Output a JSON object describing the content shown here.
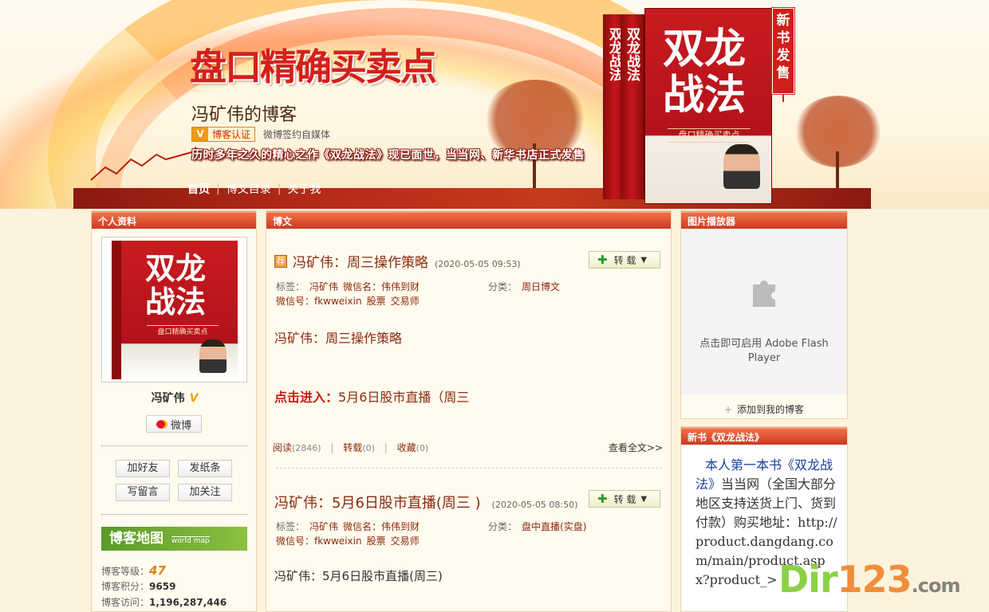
{
  "header": {
    "banner_title": "盘口精确买卖点",
    "blog_name": "冯矿伟的博客",
    "cert_badge": "博客认证",
    "cert_text": "微博签约自媒体",
    "announcement": "历时多年之久的精心之作《双龙战法》现已面世，当当网、新华书店正式发售",
    "nav": [
      {
        "label": "首页"
      },
      {
        "label": "博文目录"
      },
      {
        "label": "关于我"
      }
    ],
    "book_title_line1": "双龙",
    "book_title_line2": "战法",
    "book_subtitle": "盘口精确买卖点",
    "book_spine": "双龙战法",
    "new_tag": "新书发售"
  },
  "left": {
    "heading": "个人资料",
    "avatar_title_line1": "双龙",
    "avatar_title_line2": "战法",
    "avatar_subtitle": "盘口精确买卖点",
    "name": "冯矿伟",
    "weibo_btn": "微博",
    "buttons": [
      "加好友",
      "发纸条",
      "写留言",
      "加关注"
    ],
    "blog_map": "博客地图",
    "blog_map_sub": "world map",
    "stats": [
      {
        "label": "博客等级：",
        "value": "47"
      },
      {
        "label": "博客积分：",
        "value": "9659"
      },
      {
        "label": "博客访问：",
        "value": "1,196,287,446"
      }
    ]
  },
  "center": {
    "heading": "博文",
    "posts": [
      {
        "badge": "荐",
        "title": "冯矿伟：周三操作策略",
        "date": "(2020-05-05 09:53)",
        "share_label": "转 载",
        "tags_label": "标签：",
        "tags_line1": [
          "冯矿伟",
          "微信名：伟伟到财"
        ],
        "tags_line2": [
          "微信号：fkwweixin",
          "股票",
          "交易师"
        ],
        "category_label": "分类：",
        "category": "周日博文",
        "body": "冯矿伟：周三操作策略",
        "body2_prefix": "点击进入：",
        "body2": "5月6日股市直播（周三",
        "read_label": "阅读",
        "read_count": "(2846)",
        "repost_label": "转载",
        "repost_count": "(0)",
        "fav_label": "收藏",
        "fav_count": "(0)",
        "view_all": "查看全文>>"
      },
      {
        "title": "冯矿伟：5月6日股市直播(周三 )",
        "date": "(2020-05-05 08:50)",
        "share_label": "转 载",
        "tags_label": "标签：",
        "tags_line1": [
          "冯矿伟",
          "微信名：伟伟到财"
        ],
        "tags_line2": [
          "微信号：fkwweixin",
          "股票",
          "交易师"
        ],
        "category_label": "分类：",
        "category": "盘中直播(实盘)",
        "body": "冯矿伟：5月6日股市直播(周三)"
      }
    ]
  },
  "right": {
    "player_heading": "图片播放器",
    "flash_text": "点击即可启用 Adobe Flash Player",
    "add_to_blog": "添加到我的博客",
    "book_heading": "新书《双龙战法》",
    "book_text_a": "本人第一本书《双龙战法》",
    "book_text_b": "当当网（全国大部分地区支持送货上门、货到付款）购买地址：",
    "book_url": "http://product.dangdang.com/main/product.aspx?product_>"
  },
  "watermark": {
    "a": "Dir",
    "b": "123",
    "c": ".com"
  },
  "colors": {
    "accent": "#cc3a20",
    "title_red": "#d4201a",
    "text_brown": "#8b2a10",
    "bg": "#fdf3dc"
  }
}
